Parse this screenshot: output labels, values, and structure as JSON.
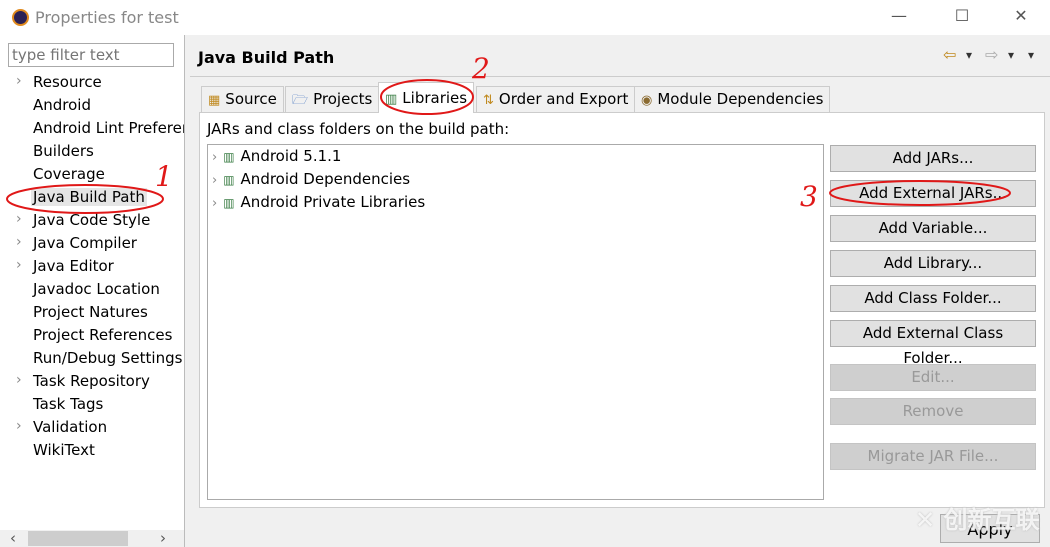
{
  "window": {
    "title": "Properties for test",
    "minimize": "—",
    "maximize": "☐",
    "close": "✕"
  },
  "filter": {
    "placeholder": "type filter text"
  },
  "sidebar": {
    "items": [
      {
        "label": "Resource",
        "expandable": true
      },
      {
        "label": "Android",
        "expandable": false
      },
      {
        "label": "Android Lint Preferences",
        "expandable": false
      },
      {
        "label": "Builders",
        "expandable": false
      },
      {
        "label": "Coverage",
        "expandable": false
      },
      {
        "label": "Java Build Path",
        "expandable": false,
        "selected": true
      },
      {
        "label": "Java Code Style",
        "expandable": true
      },
      {
        "label": "Java Compiler",
        "expandable": true
      },
      {
        "label": "Java Editor",
        "expandable": true
      },
      {
        "label": "Javadoc Location",
        "expandable": false
      },
      {
        "label": "Project Natures",
        "expandable": false
      },
      {
        "label": "Project References",
        "expandable": false
      },
      {
        "label": "Run/Debug Settings",
        "expandable": false
      },
      {
        "label": "Task Repository",
        "expandable": true
      },
      {
        "label": "Task Tags",
        "expandable": false
      },
      {
        "label": "Validation",
        "expandable": true
      },
      {
        "label": "WikiText",
        "expandable": false
      }
    ]
  },
  "page": {
    "title": "Java Build Path",
    "label": "JARs and class folders on the build path:"
  },
  "nav": {
    "back": "⇦",
    "forward": "⇨",
    "menu": "▾"
  },
  "tabs": [
    {
      "label": "Source",
      "icon": "source-folder-icon"
    },
    {
      "label": "Projects",
      "icon": "folder-icon"
    },
    {
      "label": "Libraries",
      "icon": "library-icon",
      "active": true
    },
    {
      "label": "Order and Export",
      "icon": "order-icon"
    },
    {
      "label": "Module Dependencies",
      "icon": "module-icon"
    }
  ],
  "libraries": [
    "Android 5.1.1",
    "Android Dependencies",
    "Android Private Libraries"
  ],
  "buttons": [
    {
      "label": "Add JARs...",
      "enabled": true
    },
    {
      "label": "Add External JARs...",
      "enabled": true
    },
    {
      "label": "Add Variable...",
      "enabled": true
    },
    {
      "label": "Add Library...",
      "enabled": true
    },
    {
      "label": "Add Class Folder...",
      "enabled": true
    },
    {
      "label": "Add External Class Folder...",
      "enabled": true
    },
    {
      "label": "Edit...",
      "enabled": false
    },
    {
      "label": "Remove",
      "enabled": false
    },
    {
      "label": "Migrate JAR File...",
      "enabled": false
    }
  ],
  "apply": "Apply",
  "annotations": {
    "n1": "1",
    "n2": "2",
    "n3": "3",
    "color": "#e01818"
  },
  "watermark": "创新互联"
}
